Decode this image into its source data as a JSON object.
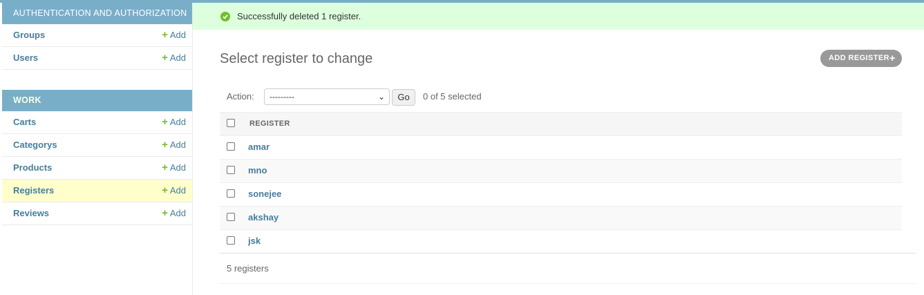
{
  "sidebar": {
    "modules": [
      {
        "caption": "AUTHENTICATION AND AUTHORIZATION",
        "models": [
          {
            "name": "Groups",
            "add": "Add"
          },
          {
            "name": "Users",
            "add": "Add"
          }
        ]
      },
      {
        "caption": "WORK",
        "models": [
          {
            "name": "Carts",
            "add": "Add"
          },
          {
            "name": "Categorys",
            "add": "Add"
          },
          {
            "name": "Products",
            "add": "Add"
          },
          {
            "name": "Registers",
            "add": "Add"
          },
          {
            "name": "Reviews",
            "add": "Add"
          }
        ]
      }
    ]
  },
  "message": {
    "text": "Successfully deleted 1 register.",
    "icon": "check-circle-icon"
  },
  "main": {
    "title": "Select register to change",
    "add_button": "ADD REGISTER",
    "add_icon": "plus-icon",
    "actions": {
      "label": "Action:",
      "selected_value": "---------",
      "go_label": "Go",
      "selected_count": "0 of 5 selected"
    },
    "table": {
      "column_header": "REGISTER",
      "rows": [
        "amar",
        "mno",
        "sonejee",
        "akshay",
        "jsk"
      ]
    },
    "paginator": "5 registers"
  },
  "colors": {
    "header_blue": "#79aec8",
    "link_blue": "#447e9b",
    "success_bg": "#ddffdd",
    "add_green": "#70bf2b",
    "current_row": "#ffffcc"
  }
}
